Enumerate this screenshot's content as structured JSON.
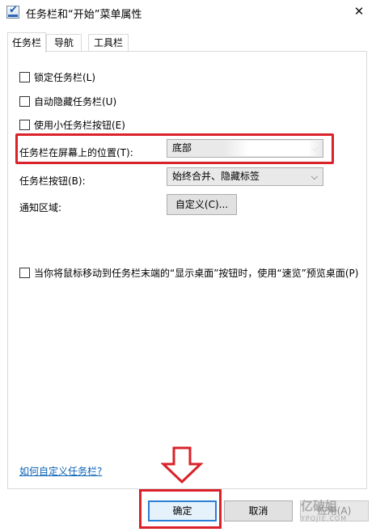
{
  "window": {
    "title": "任务栏和“开始”菜单属性",
    "close_glyph": "✕"
  },
  "tabs": [
    {
      "label": "任务栏",
      "active": true
    },
    {
      "label": "导航",
      "active": false
    },
    {
      "label": "工具栏",
      "active": false
    }
  ],
  "options": {
    "lock_taskbar": {
      "label": "锁定任务栏(L)",
      "checked": false
    },
    "auto_hide": {
      "label": "自动隐藏任务栏(U)",
      "checked": false
    },
    "small_buttons": {
      "label": "使用小任务栏按钮(E)",
      "checked": false
    },
    "peek": {
      "label": "当你将鼠标移动到任务栏末端的“显示桌面”按钮时，使用“速览”预览桌面(P)",
      "checked": false
    }
  },
  "position": {
    "label": "任务栏在屏幕上的位置(T):",
    "value": "底部"
  },
  "buttons_setting": {
    "label": "任务栏按钮(B):",
    "value": "始终合并、隐藏标签"
  },
  "notification": {
    "label": "通知区域:",
    "button_label": "自定义(C)..."
  },
  "help_link": "如何自定义任务栏?",
  "footer": {
    "ok_label": "确定",
    "cancel_label": "取消",
    "apply_label": "应用(A)"
  },
  "watermark": {
    "main": "亿破姐",
    "sub": "YPOJIE.COM"
  },
  "colors": {
    "highlight": "#d9222a",
    "link": "#0a63b8",
    "primary_border": "#2a7fd4"
  }
}
